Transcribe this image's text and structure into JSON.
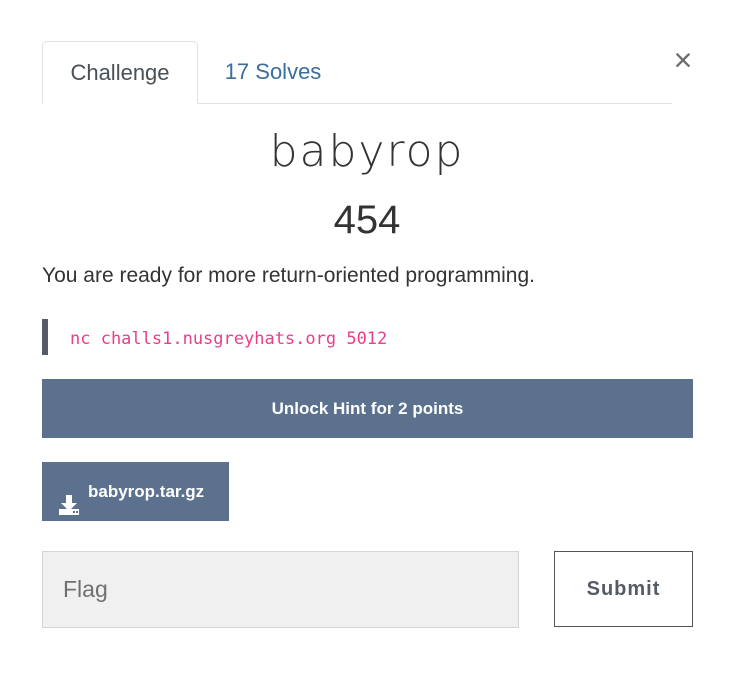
{
  "tabs": {
    "challenge": "Challenge",
    "solves": "17 Solves"
  },
  "close": "×",
  "challenge": {
    "name": "babyrop",
    "value": "454",
    "description": "You are ready for more return-oriented programming.",
    "connection": "nc challs1.nusgreyhats.org 5012"
  },
  "hint": {
    "label": "Unlock Hint for 2 points"
  },
  "file": {
    "icon": "download-icon",
    "name": "babyrop.tar.gz"
  },
  "flag": {
    "placeholder": "Flag",
    "value": ""
  },
  "submit": {
    "label": "Submit"
  },
  "colors": {
    "button_bg": "#5b718d",
    "link": "#3a6e9c",
    "code": "#e83e8c"
  }
}
